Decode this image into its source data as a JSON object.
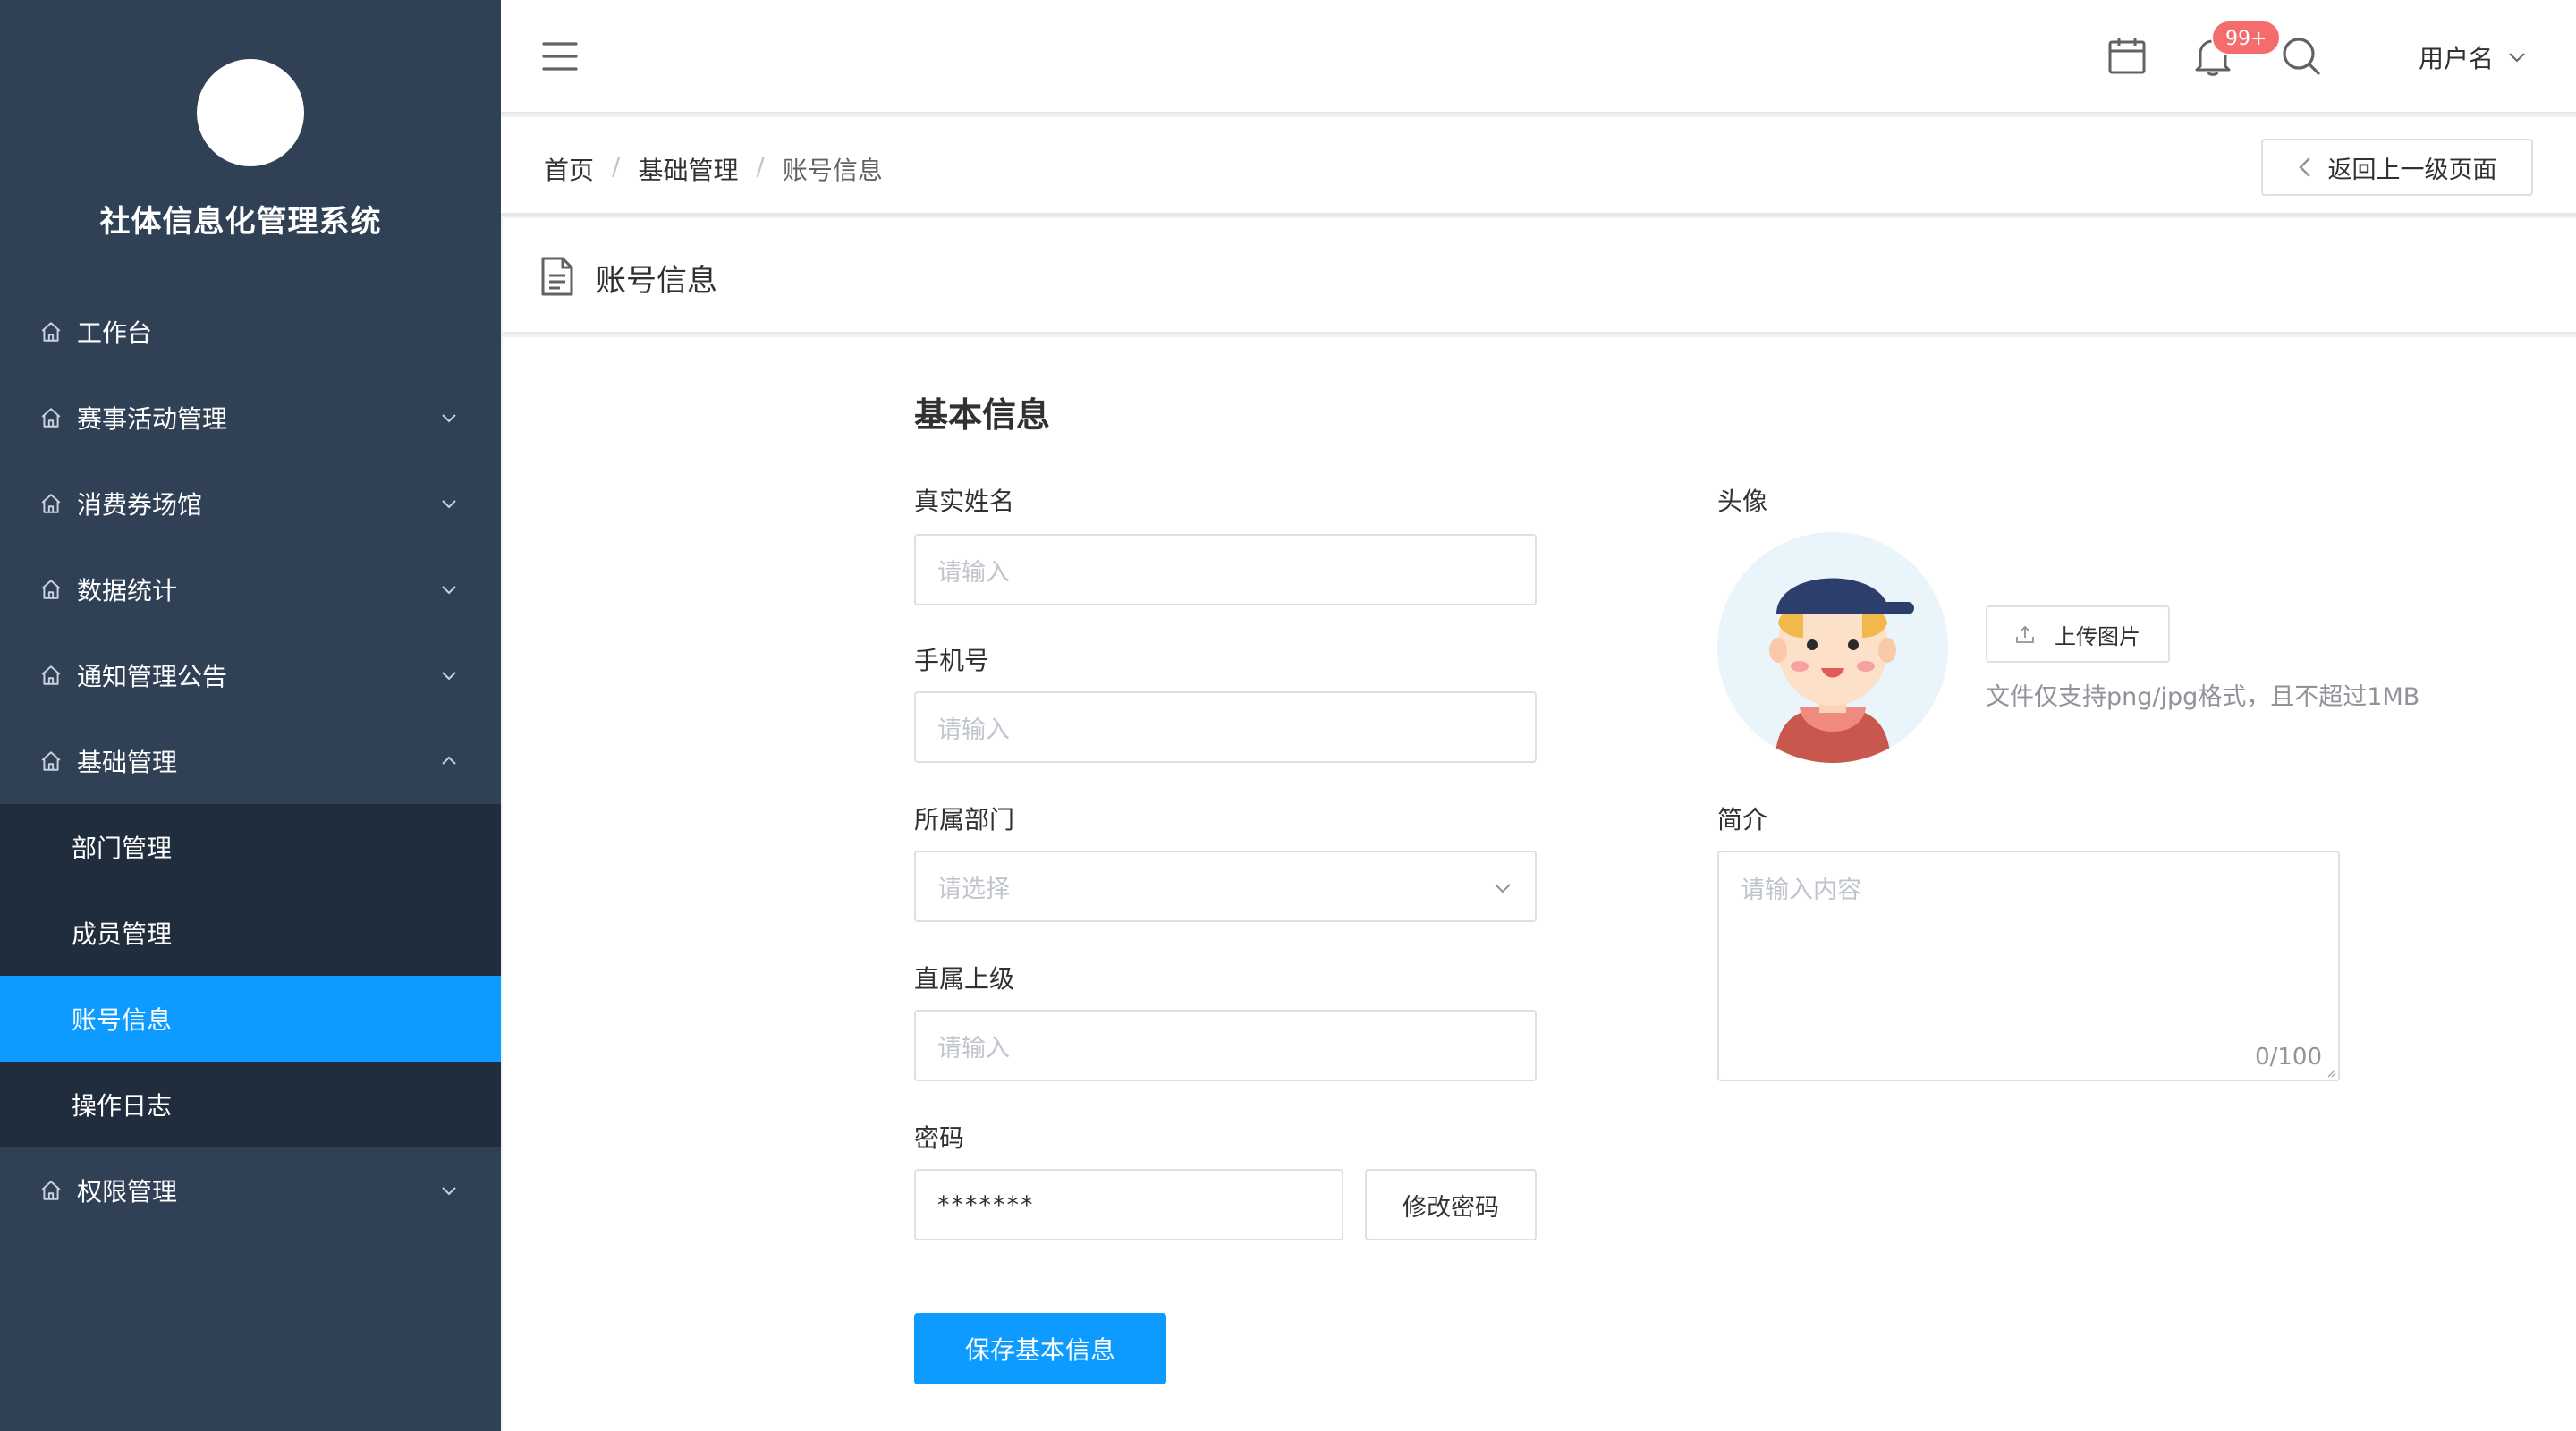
{
  "app": {
    "title": "社体信息化管理系统"
  },
  "sidebar": {
    "items": [
      {
        "label": "工作台"
      },
      {
        "label": "赛事活动管理"
      },
      {
        "label": "消费券场馆"
      },
      {
        "label": "数据统计"
      },
      {
        "label": "通知管理公告"
      },
      {
        "label": "基础管理"
      },
      {
        "label": "权限管理"
      }
    ],
    "sub_items": [
      {
        "label": "部门管理"
      },
      {
        "label": "成员管理"
      },
      {
        "label": "账号信息"
      },
      {
        "label": "操作日志"
      }
    ]
  },
  "header": {
    "notification_count": "99+",
    "username": "用户名"
  },
  "breadcrumb": {
    "home": "首页",
    "parent": "基础管理",
    "current": "账号信息",
    "separator": "/"
  },
  "back_button": {
    "label": "返回上一级页面"
  },
  "card": {
    "title": "账号信息"
  },
  "form": {
    "section_title": "基本信息",
    "real_name": {
      "label": "真实姓名",
      "placeholder": "请输入"
    },
    "phone": {
      "label": "手机号",
      "placeholder": "请输入"
    },
    "department": {
      "label": "所属部门",
      "placeholder": "请选择"
    },
    "supervisor": {
      "label": "直属上级",
      "placeholder": "请输入"
    },
    "password": {
      "label": "密码",
      "value": "*******",
      "change_label": "修改密码"
    },
    "avatar": {
      "label": "头像",
      "upload_label": "上传图片",
      "tip": "文件仅支持png/jpg格式，且不超过1MB"
    },
    "intro": {
      "label": "简介",
      "placeholder": "请输入内容",
      "counter": "0/100"
    },
    "save_label": "保存基本信息"
  },
  "colors": {
    "sidebar_bg": "#304156",
    "submenu_bg": "#1f2d3d",
    "accent": "#0d9bff",
    "badge": "#f56c6c"
  }
}
